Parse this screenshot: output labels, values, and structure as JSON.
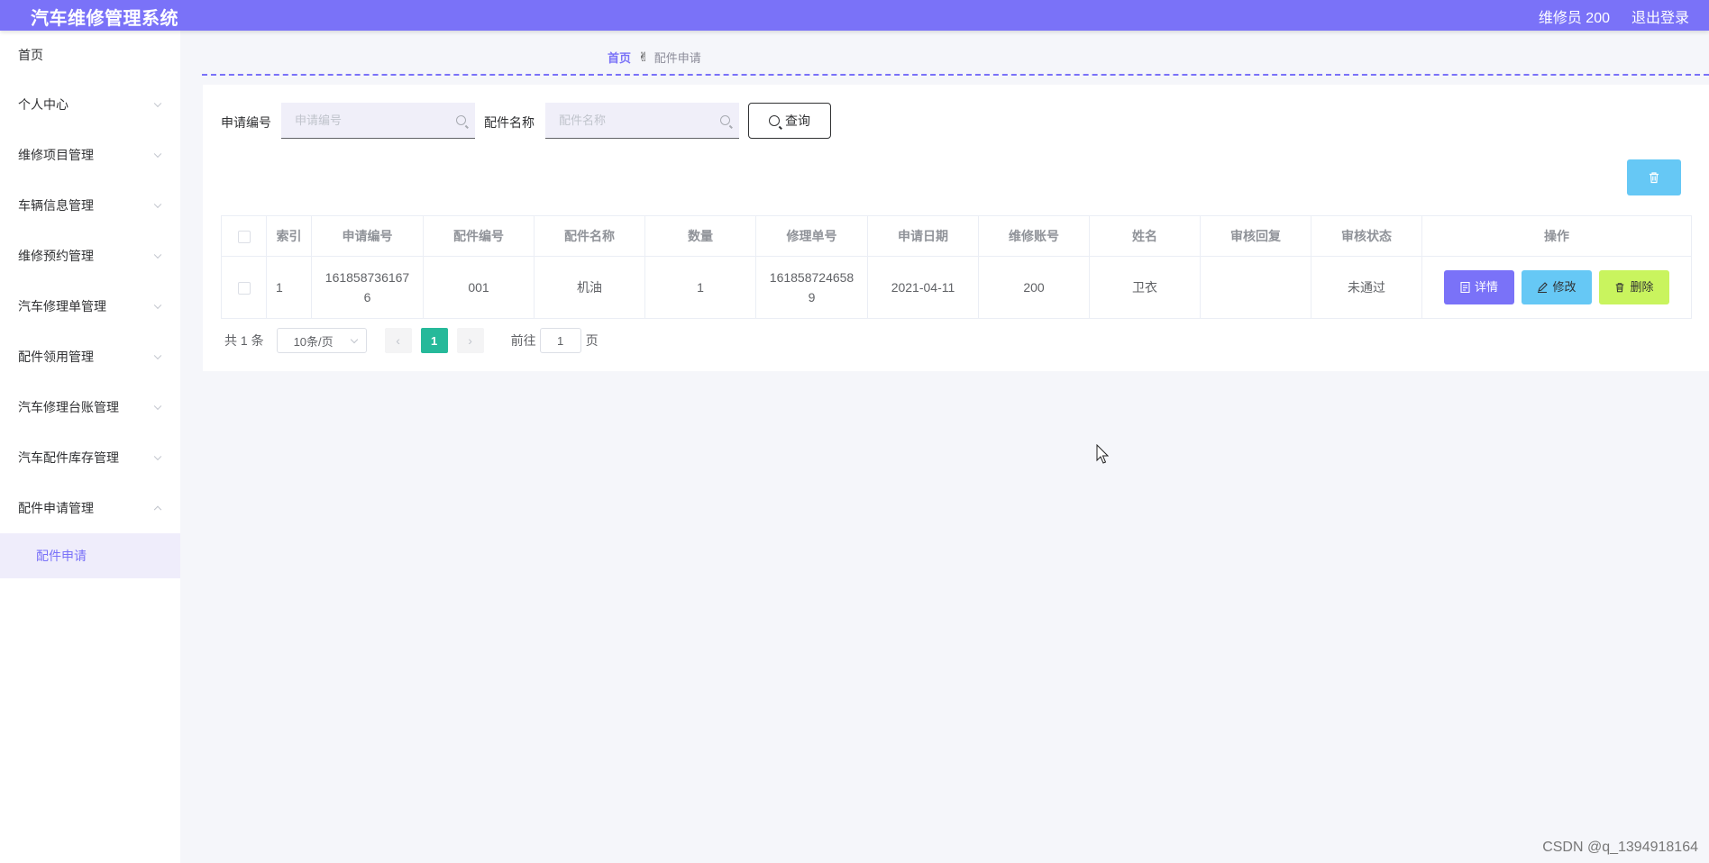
{
  "header": {
    "app_title": "汽车维修管理系统",
    "user_info": "维修员 200",
    "logout_label": "退出登录"
  },
  "sidebar": {
    "items": [
      {
        "label": "首页"
      },
      {
        "label": "个人中心"
      },
      {
        "label": "维修项目管理"
      },
      {
        "label": "车辆信息管理"
      },
      {
        "label": "维修预约管理"
      },
      {
        "label": "汽车修理单管理"
      },
      {
        "label": "配件领用管理"
      },
      {
        "label": "汽车修理台账管理"
      },
      {
        "label": "汽车配件库存管理"
      },
      {
        "label": "配件申请管理"
      }
    ],
    "active_sub": "配件申请"
  },
  "breadcrumb": {
    "home": "首页",
    "current": "配件申请"
  },
  "search": {
    "field1_label": "申请编号",
    "field1_placeholder": "申请编号",
    "field2_label": "配件名称",
    "field2_placeholder": "配件名称",
    "query_label": "查询"
  },
  "table": {
    "columns": [
      "索引",
      "申请编号",
      "配件编号",
      "配件名称",
      "数量",
      "修理单号",
      "申请日期",
      "维修账号",
      "姓名",
      "审核回复",
      "审核状态",
      "操作"
    ],
    "rows": [
      {
        "index": "1",
        "apply_no_line1": "161858736167",
        "apply_no_line2": "6",
        "part_no": "001",
        "part_name": "机油",
        "quantity": "1",
        "repair_no_line1": "161858724658",
        "repair_no_line2": "9",
        "apply_date": "2021-04-11",
        "account": "200",
        "name": "卫衣",
        "reply": "",
        "status": "未通过"
      }
    ],
    "actions": {
      "detail": "详情",
      "edit": "修改",
      "delete": "删除"
    }
  },
  "pagination": {
    "total_text": "共 1 条",
    "page_size": "10条/页",
    "current_page": "1",
    "goto_prefix": "前往",
    "goto_value": "1",
    "goto_suffix": "页"
  },
  "watermark": "CSDN @q_1394918164",
  "colors": {
    "primary": "#7a72f8",
    "info": "#66c8f5",
    "warn": "#c9f45e",
    "page_active": "#26b99a"
  }
}
